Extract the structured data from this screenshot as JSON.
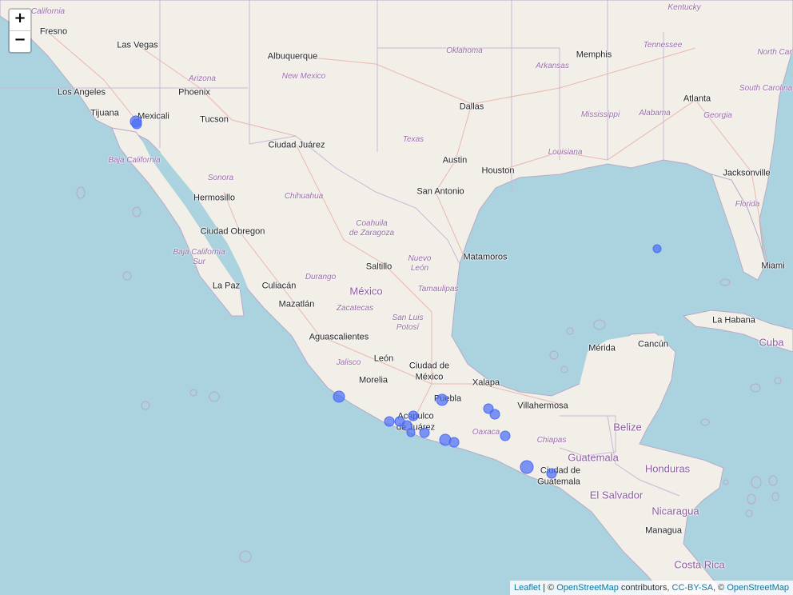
{
  "map": {
    "zoom_in_label": "+",
    "zoom_out_label": "−",
    "attribution": {
      "leaflet": "Leaflet",
      "sep": " | © ",
      "osm": "OpenStreetMap",
      "contributors": " contributors, ",
      "license": "CC-BY-SA",
      "sep2": ", © ",
      "osm2": "OpenStreetMap"
    },
    "cities": [
      "Fresno",
      "Las Vegas",
      "Albuquerque",
      "Memphis",
      "Los Angeles",
      "Phoenix",
      "Tijuana",
      "Mexicali",
      "Tucson",
      "Dallas",
      "Atlanta",
      "Ciudad Juárez",
      "Austin",
      "Houston",
      "Jacksonville",
      "San Antonio",
      "Hermosillo",
      "Ciudad Obregon",
      "Matamoros",
      "Miami",
      "Saltillo",
      "La Paz",
      "Culiacán",
      "Mazatlán",
      "La Habana",
      "Aguascalientes",
      "Mérida",
      "Cancún",
      "León",
      "Ciudad de",
      "México",
      "Xalapa",
      "Morelia",
      "Puebla",
      "Villahermosa",
      "Acapulco",
      "de Juárez",
      "Belize",
      "Ciudad de",
      "Guatemala",
      "Managua"
    ],
    "states": [
      "California",
      "Kentucky",
      "Oklahoma",
      "Tennessee",
      "North Car",
      "Arizona",
      "New Mexico",
      "Arkansas",
      "South Carolina",
      "Mississippi",
      "Alabama",
      "Georgia",
      "Texas",
      "Louisiana",
      "Baja California",
      "Sonora",
      "Chihuahua",
      "Florida",
      "Coahuila",
      "de Zaragoza",
      "Nuevo",
      "León",
      "Baja California",
      "Sur",
      "Durango",
      "Tamaulipas",
      "Zacatecas",
      "San Luis",
      "Potosí",
      "Jalisco",
      "Oaxaca",
      "Chiapas"
    ],
    "countries": [
      "México",
      "Cuba",
      "Belize",
      "Guatemala",
      "Honduras",
      "El Salvador",
      "Nicaragua",
      "Costa Rica"
    ],
    "marker_color": "#4a6cf7",
    "land_color": "#f2efe9",
    "water_color": "#aad3df"
  }
}
